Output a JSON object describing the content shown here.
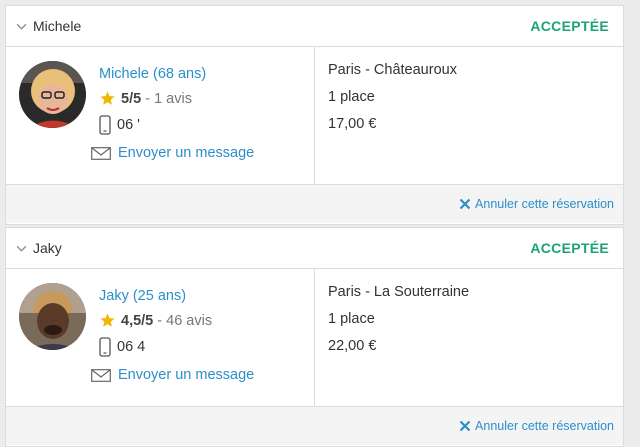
{
  "colors": {
    "accent": "#2b8fc9",
    "status_green": "#1aa37a",
    "star": "#f2b705"
  },
  "icons": [
    "chevron-down-icon",
    "star-icon",
    "phone-icon",
    "mail-icon",
    "close-icon"
  ],
  "reservations": [
    {
      "header_name": "Michele",
      "status": "ACCEPTÉE",
      "name": "Michele (68 ans)",
      "score": "5/5",
      "reviews": "1 avis",
      "phone": "06 '",
      "message": "Envoyer un message",
      "route": "Paris - Châteauroux",
      "seats": "1 place",
      "price": "17,00 €",
      "cancel": "Annuler cette réservation"
    },
    {
      "header_name": "Jaky",
      "status": "ACCEPTÉE",
      "name": "Jaky (25 ans)",
      "score": "4,5/5",
      "reviews": "46 avis",
      "phone": "06 4",
      "message": "Envoyer un message",
      "route": "Paris - La Souterraine",
      "seats": "1 place",
      "price": "22,00 €",
      "cancel": "Annuler cette réservation"
    }
  ]
}
